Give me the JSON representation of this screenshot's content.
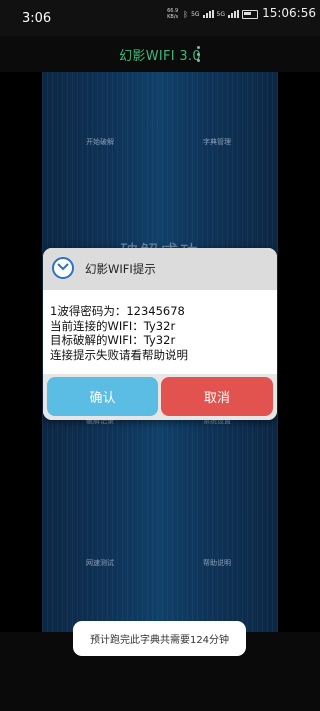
{
  "status_bar": {
    "time": "3:06",
    "clock": "15:06:56",
    "net_speed_value": "66.9",
    "net_speed_unit": "KB/s",
    "bt_icon": "bluetooth-icon",
    "signal_labels": [
      "5G",
      "5G"
    ]
  },
  "app_bar": {
    "title": "幻影WIFI 3.0",
    "menu_icon": "more-vert-icon"
  },
  "menu": {
    "start_crack": "开始破解",
    "dictionary_manage": "字典管理",
    "obscured_left": "破解记录",
    "obscured_right": "系统设置",
    "speed_test": "网速测试",
    "help": "帮助说明"
  },
  "background_text": "破解成功",
  "dialog": {
    "title": "幻影WIFI提示",
    "lines": [
      "1波得密码为：12345678",
      "当前连接的WIFI：Ty32r",
      "目标破解的WIFI：Ty32r",
      "连接提示失败请看帮助说明"
    ],
    "ok_label": "确认",
    "cancel_label": "取消"
  },
  "toast": {
    "text": "预计跑完此字典共需要124分钟"
  },
  "colors": {
    "accent_green": "#3fb878",
    "ok_blue": "#5bbde4",
    "cancel_red": "#e2534f"
  }
}
